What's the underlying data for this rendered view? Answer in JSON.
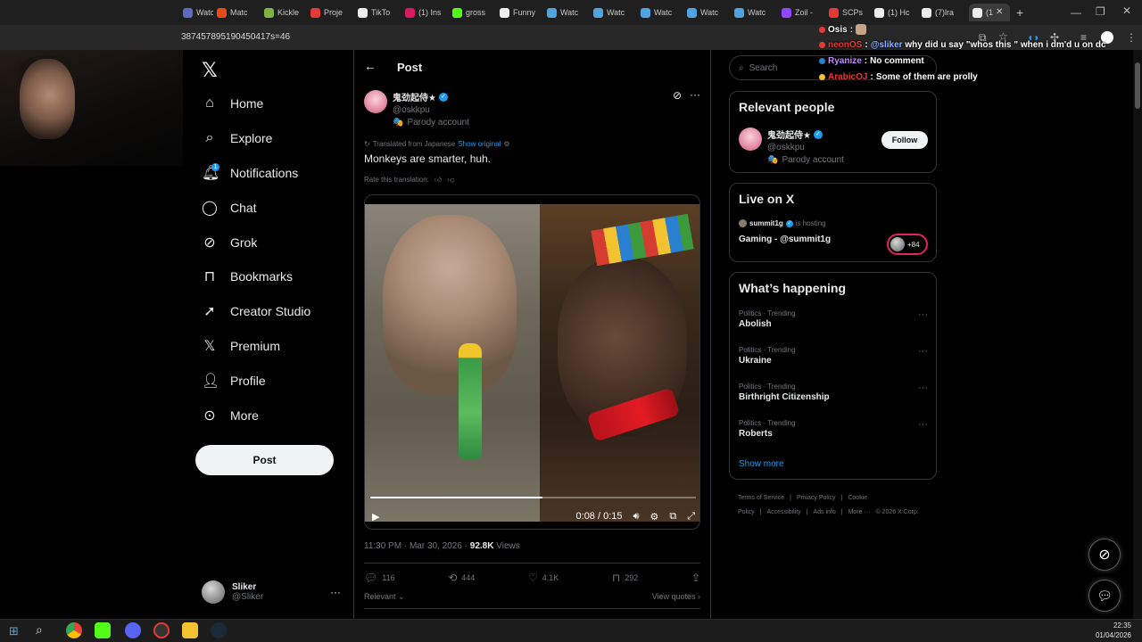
{
  "browser": {
    "tabs": [
      {
        "label": "Watc",
        "color": "#5c6bc0"
      },
      {
        "label": "Matc",
        "color": "#e64a19"
      },
      {
        "label": "Kickle",
        "color": "#7cb342"
      },
      {
        "label": "Proje",
        "color": "#e53935"
      },
      {
        "label": "TikTo",
        "color": "#eeeeee"
      },
      {
        "label": "(1) Ins",
        "color": "#d81b60"
      },
      {
        "label": "gross",
        "color": "#53fc18"
      },
      {
        "label": "Funny",
        "color": "#eeeeee"
      },
      {
        "label": "Watc",
        "color": "#4fa3e0"
      },
      {
        "label": "Watc",
        "color": "#4fa3e0"
      },
      {
        "label": "Watc",
        "color": "#4fa3e0"
      },
      {
        "label": "Watc",
        "color": "#4fa3e0"
      },
      {
        "label": "Watc",
        "color": "#4fa3e0"
      },
      {
        "label": "Zoil -",
        "color": "#9146ff"
      },
      {
        "label": "SCPs",
        "color": "#e53935"
      },
      {
        "label": "(1) Hc",
        "color": "#eeeeee"
      },
      {
        "label": "(7)lra",
        "color": "#eeeeee"
      },
      {
        "label": "(1",
        "color": "#eeeeee"
      }
    ],
    "url": "387457895190450417s=46",
    "new_tab": "+"
  },
  "chat": [
    {
      "user": "Osis",
      "user_color": "#ffffff",
      "message": "",
      "badge": "#e53935"
    },
    {
      "user": "neonOS",
      "user_color": "#e53935",
      "message": "@sliker why did u say \"whos this \" when i dm'd u on dc",
      "mention": "@sliker",
      "badge": "#e53935"
    },
    {
      "user": "Ryanize",
      "user_color": "#c586ff",
      "message": "No comment",
      "badge": "#2a7fd1"
    },
    {
      "user": "ArabicOJ",
      "user_color": "#e53935",
      "message": "Some of them are prolly",
      "badge": "#f2c230"
    }
  ],
  "sidebar": {
    "items": [
      {
        "label": "Home",
        "icon": "home-icon"
      },
      {
        "label": "Explore",
        "icon": "search-icon"
      },
      {
        "label": "Notifications",
        "icon": "bell-icon",
        "badge": "1"
      },
      {
        "label": "Chat",
        "icon": "chat-icon"
      },
      {
        "label": "Grok",
        "icon": "grok-icon"
      },
      {
        "label": "Bookmarks",
        "icon": "bookmark-icon"
      },
      {
        "label": "Creator Studio",
        "icon": "rocket-icon"
      },
      {
        "label": "Premium",
        "icon": "x-icon"
      },
      {
        "label": "Profile",
        "icon": "person-icon"
      },
      {
        "label": "More",
        "icon": "more-circle-icon"
      }
    ],
    "post_button": "Post",
    "account": {
      "name": "Sliker",
      "handle": "@Sliker"
    }
  },
  "post": {
    "header": "Post",
    "author": {
      "name": "鬼劲起侍★",
      "handle": "@oskkpu",
      "label": "Parody account"
    },
    "translated_from": "Translated from Japanese",
    "show_original": "Show original",
    "text": "Monkeys are smarter, huh.",
    "rate_translation": "Rate this translation:",
    "video": {
      "time": "0:08 / 0:15",
      "progress": 0.53
    },
    "timestamp": "11:30 PM · Mar 30, 2026 · ",
    "views_count": "92.8K",
    "views_label": " Views",
    "stats": {
      "replies": "116",
      "reposts": "444",
      "likes": "4.1K",
      "bookmarks": "292"
    },
    "sort": "Relevant",
    "view_quotes": "View quotes"
  },
  "right": {
    "search_placeholder": "Search",
    "relevant_people": {
      "title": "Relevant people",
      "name": "鬼劲起侍★",
      "handle": "@oskkpu",
      "label": "Parody account",
      "follow": "Follow"
    },
    "live": {
      "title": "Live on X",
      "host": "summit1g",
      "hosting": "is hosting",
      "stream": "Gaming - @summit1g",
      "listeners": "+84"
    },
    "happening": {
      "title": "What’s happening",
      "trends": [
        {
          "meta": "Politics · Trending",
          "name": "Abolish"
        },
        {
          "meta": "Politics · Trending",
          "name": "Ukraine"
        },
        {
          "meta": "Politics · Trending",
          "name": "Birthright Citizenship"
        },
        {
          "meta": "Politics · Trending",
          "name": "Roberts"
        }
      ],
      "show_more": "Show more"
    },
    "footer": [
      "Terms of Service",
      "|",
      "Privacy Policy",
      "|",
      "Cookie Policy",
      "|",
      "Accessibility",
      "|",
      "Ads info",
      "|",
      "More ···",
      "© 2026 X Corp."
    ]
  },
  "taskbar": {
    "time": "22:35",
    "date": "01/04/2026"
  },
  "colors": {
    "accent": "#1d9bf0",
    "background": "#000000",
    "border": "#2f3336",
    "muted": "#71767b"
  }
}
